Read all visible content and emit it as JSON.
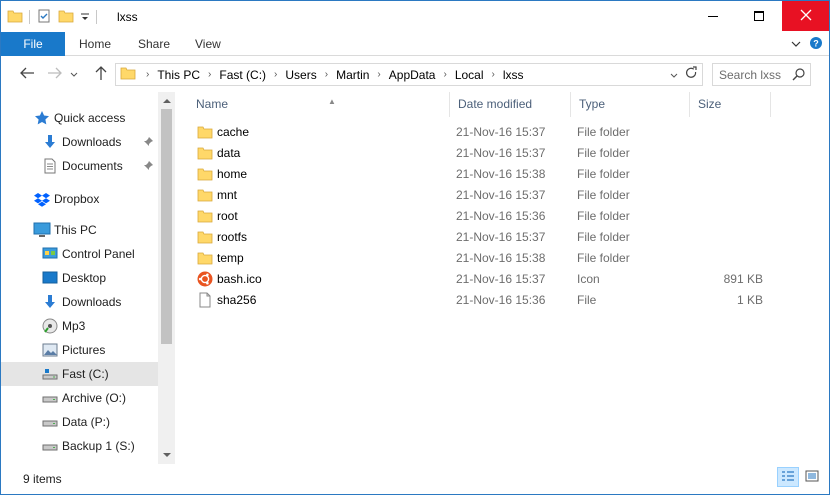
{
  "window": {
    "title": "lxss",
    "colors": {
      "accent": "#1979ca",
      "close": "#e81123",
      "folder": "#ffd869"
    }
  },
  "ribbon": {
    "tabs": [
      {
        "label": "File"
      },
      {
        "label": "Home"
      },
      {
        "label": "Share"
      },
      {
        "label": "View"
      }
    ]
  },
  "address": {
    "crumbs": [
      "This PC",
      "Fast (C:)",
      "Users",
      "Martin",
      "AppData",
      "Local",
      "lxss"
    ]
  },
  "search": {
    "placeholder": "Search lxss"
  },
  "nav_pane": {
    "items": [
      {
        "label": "Quick access",
        "icon": "star-icon",
        "pinned": false
      },
      {
        "label": "Downloads",
        "icon": "download-arrow-icon",
        "pinned": true
      },
      {
        "label": "Documents",
        "icon": "document-icon",
        "pinned": true
      },
      {
        "label": "Dropbox",
        "icon": "dropbox-icon",
        "pinned": false
      },
      {
        "label": "This PC",
        "icon": "monitor-icon",
        "pinned": false
      },
      {
        "label": "Control Panel",
        "icon": "control-panel-icon",
        "pinned": false
      },
      {
        "label": "Desktop",
        "icon": "desktop-icon",
        "pinned": false
      },
      {
        "label": "Downloads",
        "icon": "download-arrow-icon",
        "pinned": false
      },
      {
        "label": "Mp3",
        "icon": "music-icon",
        "pinned": false
      },
      {
        "label": "Pictures",
        "icon": "pictures-icon",
        "pinned": false
      },
      {
        "label": "Fast (C:)",
        "icon": "drive-icon",
        "pinned": false,
        "selected": true
      },
      {
        "label": "Archive (O:)",
        "icon": "drive-icon",
        "pinned": false
      },
      {
        "label": "Data (P:)",
        "icon": "drive-icon",
        "pinned": false
      },
      {
        "label": "Backup 1 (S:)",
        "icon": "drive-icon",
        "pinned": false
      }
    ]
  },
  "columns": [
    "Name",
    "Date modified",
    "Type",
    "Size"
  ],
  "files": [
    {
      "name": "cache",
      "date": "21-Nov-16 15:37",
      "type": "File folder",
      "size": "",
      "icon": "folder-icon"
    },
    {
      "name": "data",
      "date": "21-Nov-16 15:37",
      "type": "File folder",
      "size": "",
      "icon": "folder-icon"
    },
    {
      "name": "home",
      "date": "21-Nov-16 15:38",
      "type": "File folder",
      "size": "",
      "icon": "folder-icon"
    },
    {
      "name": "mnt",
      "date": "21-Nov-16 15:37",
      "type": "File folder",
      "size": "",
      "icon": "folder-icon"
    },
    {
      "name": "root",
      "date": "21-Nov-16 15:36",
      "type": "File folder",
      "size": "",
      "icon": "folder-icon"
    },
    {
      "name": "rootfs",
      "date": "21-Nov-16 15:37",
      "type": "File folder",
      "size": "",
      "icon": "folder-icon"
    },
    {
      "name": "temp",
      "date": "21-Nov-16 15:38",
      "type": "File folder",
      "size": "",
      "icon": "folder-icon"
    },
    {
      "name": "bash.ico",
      "date": "21-Nov-16 15:37",
      "type": "Icon",
      "size": "891 KB",
      "icon": "ubuntu-icon"
    },
    {
      "name": "sha256",
      "date": "21-Nov-16 15:36",
      "type": "File",
      "size": "1 KB",
      "icon": "file-icon"
    }
  ],
  "status": {
    "item_count": "9 items"
  }
}
